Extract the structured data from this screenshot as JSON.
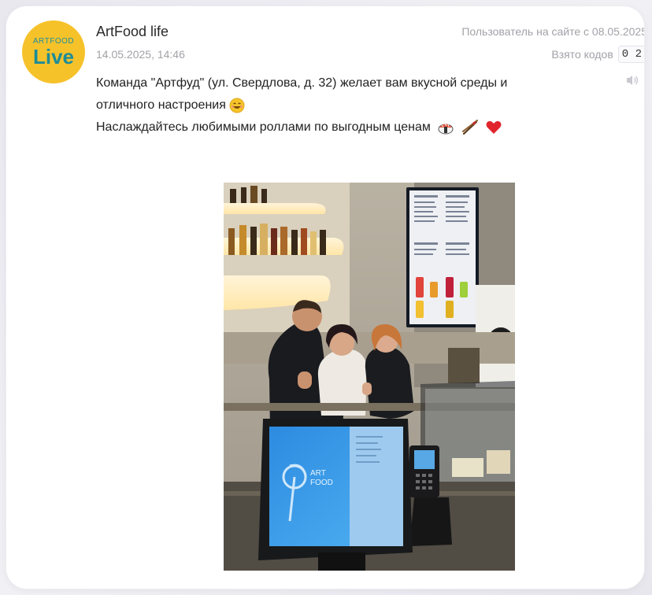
{
  "post": {
    "avatar": {
      "small_text": "ARTFOOD",
      "big_text": "Live",
      "bg_color": "#f6c22a",
      "text_color": "#1d8c98"
    },
    "author": "ArtFood life",
    "date": "14.05.2025, 14:46",
    "member_since": "Пользователь на сайте с 08.05.2025",
    "codes_label": "Взято кодов",
    "codes_value": "0 2",
    "text_line1": "Команда \"Артфуд\" (ул. Свердлова, д. 32) желает вам вкусной среды и",
    "text_line2": "отличного настроения",
    "text_line3": "Наслаждайтесь любимыми роллами по выгодным ценам",
    "photo": {
      "pos_brand_line1": "ART",
      "pos_brand_line2": "FOOD"
    }
  }
}
